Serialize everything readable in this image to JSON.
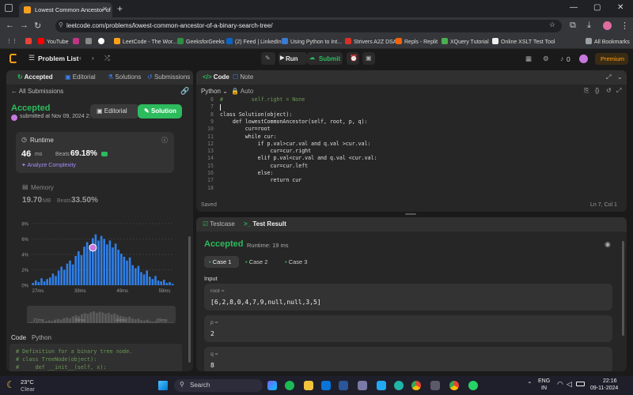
{
  "browser": {
    "tab_title": "Lowest Common Ancestor of a",
    "url": "leetcode.com/problems/lowest-common-ancestor-of-a-binary-search-tree/",
    "bookmarks": [
      "YouTube",
      "LeetCode - The Wor...",
      "GeeksforGeeks",
      "(2) Feed | LinkedIn",
      "Using Python to Int...",
      "Strivers A2Z DSA",
      "Repls - Replit",
      "XQuery Tutorial",
      "Online XSLT Test Tool",
      "All Bookmarks"
    ]
  },
  "lc_header": {
    "problem_list": "Problem List",
    "run": "Run",
    "submit": "Submit",
    "coins": "0",
    "premium": "Premium"
  },
  "left_tabs": [
    "Accepted",
    "Editorial",
    "Solutions",
    "Submissions"
  ],
  "submission": {
    "back": "All Submissions",
    "status": "Accepted",
    "submitted": "submitted at Nov 09, 2024 2:",
    "editorial_btn": "Editorial",
    "solution_btn": "Solution",
    "runtime_label": "Runtime",
    "runtime_value": "46",
    "runtime_unit": "ms",
    "beats_label": "Beats",
    "runtime_beats": "69.18%",
    "analyze": "Analyze Complexity",
    "memory_label": "Memory",
    "memory_value": "19.70",
    "memory_unit": "MB",
    "memory_beats": "33.50%"
  },
  "chart_data": {
    "type": "bar",
    "y_tick_labels": [
      "8%",
      "6%",
      "4%",
      "2%",
      "0%"
    ],
    "x_tick_labels": [
      "27ms",
      "39ms",
      "49ms",
      "59ms"
    ],
    "mini_x_tick_labels": [
      "27ms",
      "39ms",
      "49ms",
      "59ms"
    ],
    "ylim": [
      0,
      8
    ],
    "values": [
      0.3,
      0.6,
      0.4,
      0.9,
      0.5,
      0.8,
      1.0,
      1.5,
      1.2,
      1.9,
      2.4,
      2.0,
      2.8,
      3.2,
      2.7,
      3.8,
      4.4,
      3.9,
      5.0,
      5.6,
      5.2,
      6.1,
      6.6,
      5.8,
      6.4,
      6.0,
      5.3,
      5.8,
      4.9,
      5.4,
      4.6,
      4.1,
      3.7,
      3.2,
      3.6,
      2.6,
      2.2,
      2.5,
      1.7,
      1.4,
      1.9,
      1.1,
      0.8,
      1.2,
      0.6,
      0.5,
      0.7,
      0.3,
      0.4,
      0.2
    ],
    "highlight_index": 21,
    "bar_color": "#2f7fe8"
  },
  "code_mini": {
    "tab_code": "Code",
    "lang": "Python",
    "lines": [
      "# Definition for a binary tree node.",
      "# class TreeNode(object):",
      "#     def __init__(self, x):"
    ]
  },
  "editor": {
    "tab_code": "Code",
    "tab_note": "Note",
    "lang": "Python",
    "mode": "Auto",
    "lines": [
      {
        "n": "6",
        "t": "#         self.right = None",
        "c": "cmt"
      },
      {
        "n": "7",
        "t": "",
        "c": "fld"
      },
      {
        "n": "8",
        "t": "class Solution(object):",
        "c": "fld"
      },
      {
        "n": "9",
        "t": "    def lowestCommonAncestor(self, root, p, q):",
        "c": "fld"
      },
      {
        "n": "10",
        "t": "        cur=root",
        "c": "fld"
      },
      {
        "n": "11",
        "t": "        while cur:",
        "c": "fld"
      },
      {
        "n": "12",
        "t": "            if p.val>cur.val and q.val >cur.val:",
        "c": "fld"
      },
      {
        "n": "13",
        "t": "                cur=cur.right",
        "c": "fld"
      },
      {
        "n": "14",
        "t": "            elif p.val<cur.val and q.val <cur.val:",
        "c": "fld"
      },
      {
        "n": "15",
        "t": "                cur=cur.left",
        "c": "fld"
      },
      {
        "n": "16",
        "t": "            else:",
        "c": "fld"
      },
      {
        "n": "17",
        "t": "                return cur",
        "c": "fld"
      },
      {
        "n": "18",
        "t": "",
        "c": "fld"
      }
    ],
    "saved": "Saved",
    "cursor": "Ln 7, Col 1"
  },
  "result": {
    "tab_testcase": "Testcase",
    "tab_result": "Test Result",
    "status": "Accepted",
    "runtime": "Runtime: 19 ms",
    "cases": [
      "Case 1",
      "Case 2",
      "Case 3"
    ],
    "input_label": "Input",
    "root_label": "root =",
    "root_value": "[6,2,8,0,4,7,9,null,null,3,5]",
    "p_label": "p =",
    "p_value": "2",
    "q_label": "q =",
    "q_value": "8"
  },
  "taskbar": {
    "weather_temp": "23°C",
    "weather_text": "Clear",
    "search": "Search",
    "lang1": "ENG",
    "lang2": "IN",
    "time": "22:16",
    "date": "09-11-2024"
  }
}
